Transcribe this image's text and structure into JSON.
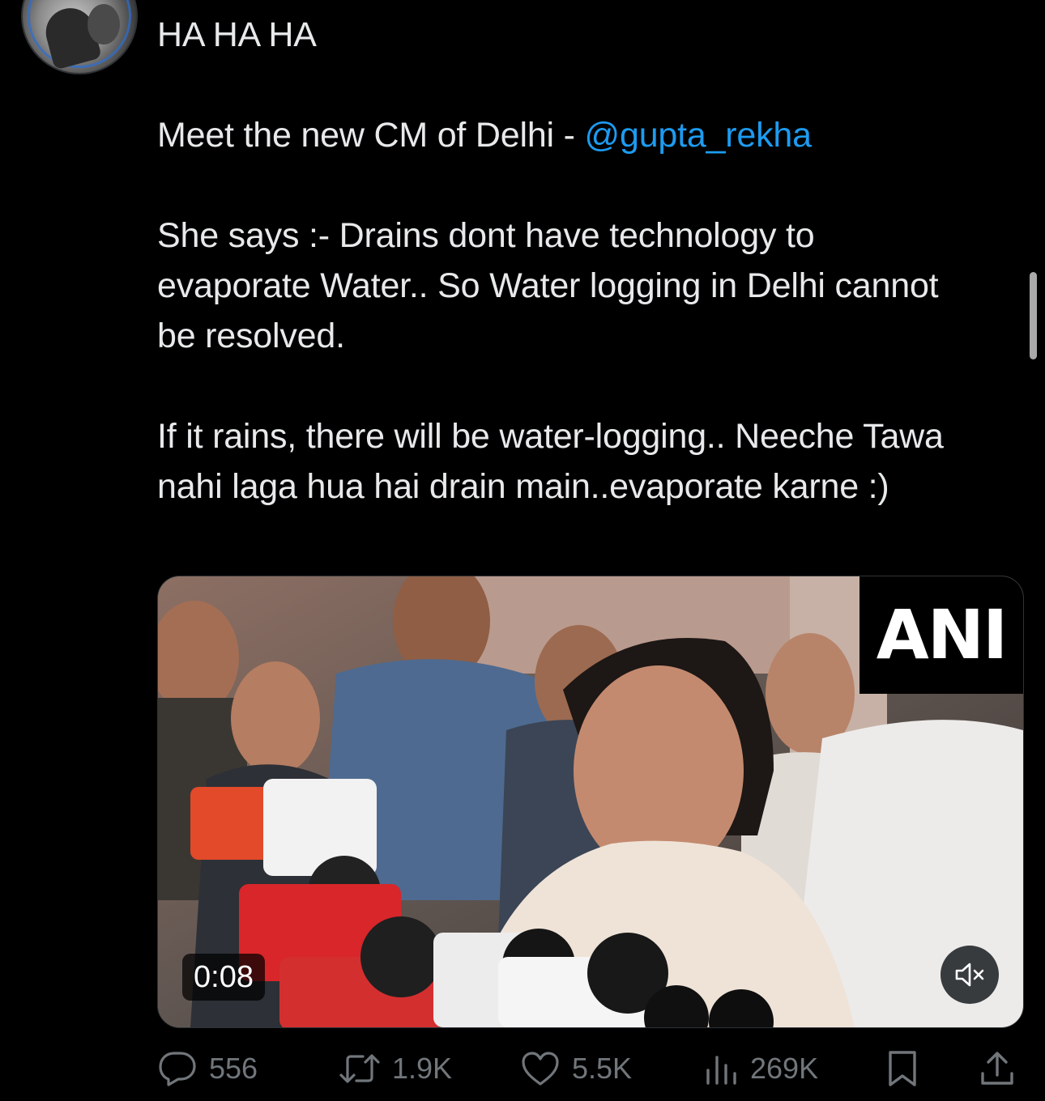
{
  "tweet": {
    "line1": "HA HA HA",
    "line2_prefix": "Meet the new CM of Delhi - ",
    "mention": "@gupta_rekha",
    "para3": "She says :- Drains dont have technology to evaporate Water.. So Water logging in Delhi cannot be resolved.",
    "para4": "If it rains, there will be water-logging.. Neeche Tawa nahi laga hua hai drain main..evaporate karne :)"
  },
  "media": {
    "logo_text": "ANI",
    "timestamp": "0:08",
    "mute_icon": "speaker-muted-icon"
  },
  "actions": {
    "replies": "556",
    "reposts": "1.9K",
    "likes": "5.5K",
    "views": "269K",
    "icons": {
      "reply": "reply-icon",
      "repost": "repost-icon",
      "like": "heart-icon",
      "views": "views-chart-icon",
      "bookmark": "bookmark-icon",
      "share": "share-icon"
    }
  },
  "colors": {
    "background": "#000000",
    "text": "#e7e9ea",
    "mention": "#1d9bf0",
    "muted": "#71767b"
  }
}
